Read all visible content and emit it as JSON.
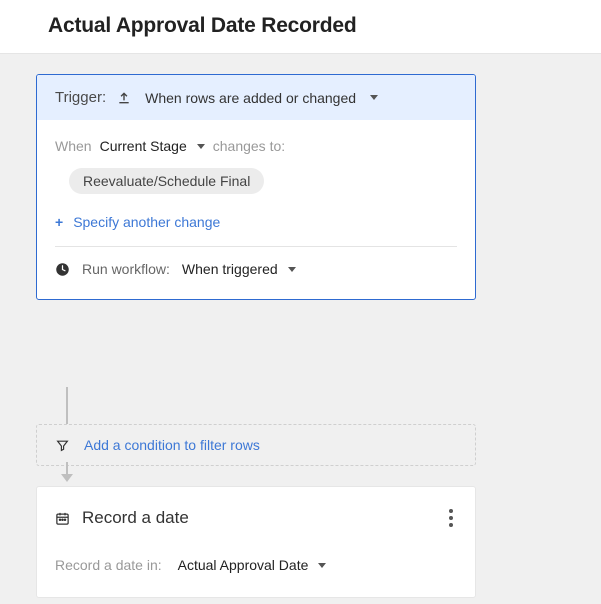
{
  "header": {
    "title": "Actual Approval Date Recorded"
  },
  "trigger": {
    "label": "Trigger:",
    "type_label": "When rows are added or changed",
    "when_label": "When",
    "field": "Current Stage",
    "changes_to_label": "changes to:",
    "changes_to_value": "Reevaluate/Schedule Final",
    "add_change_label": "Specify another change",
    "run_label": "Run workflow:",
    "run_value": "When triggered"
  },
  "condition": {
    "label": "Add a condition to filter rows"
  },
  "action": {
    "title": "Record a date",
    "field_label": "Record a date in:",
    "field_value": "Actual Approval Date"
  }
}
